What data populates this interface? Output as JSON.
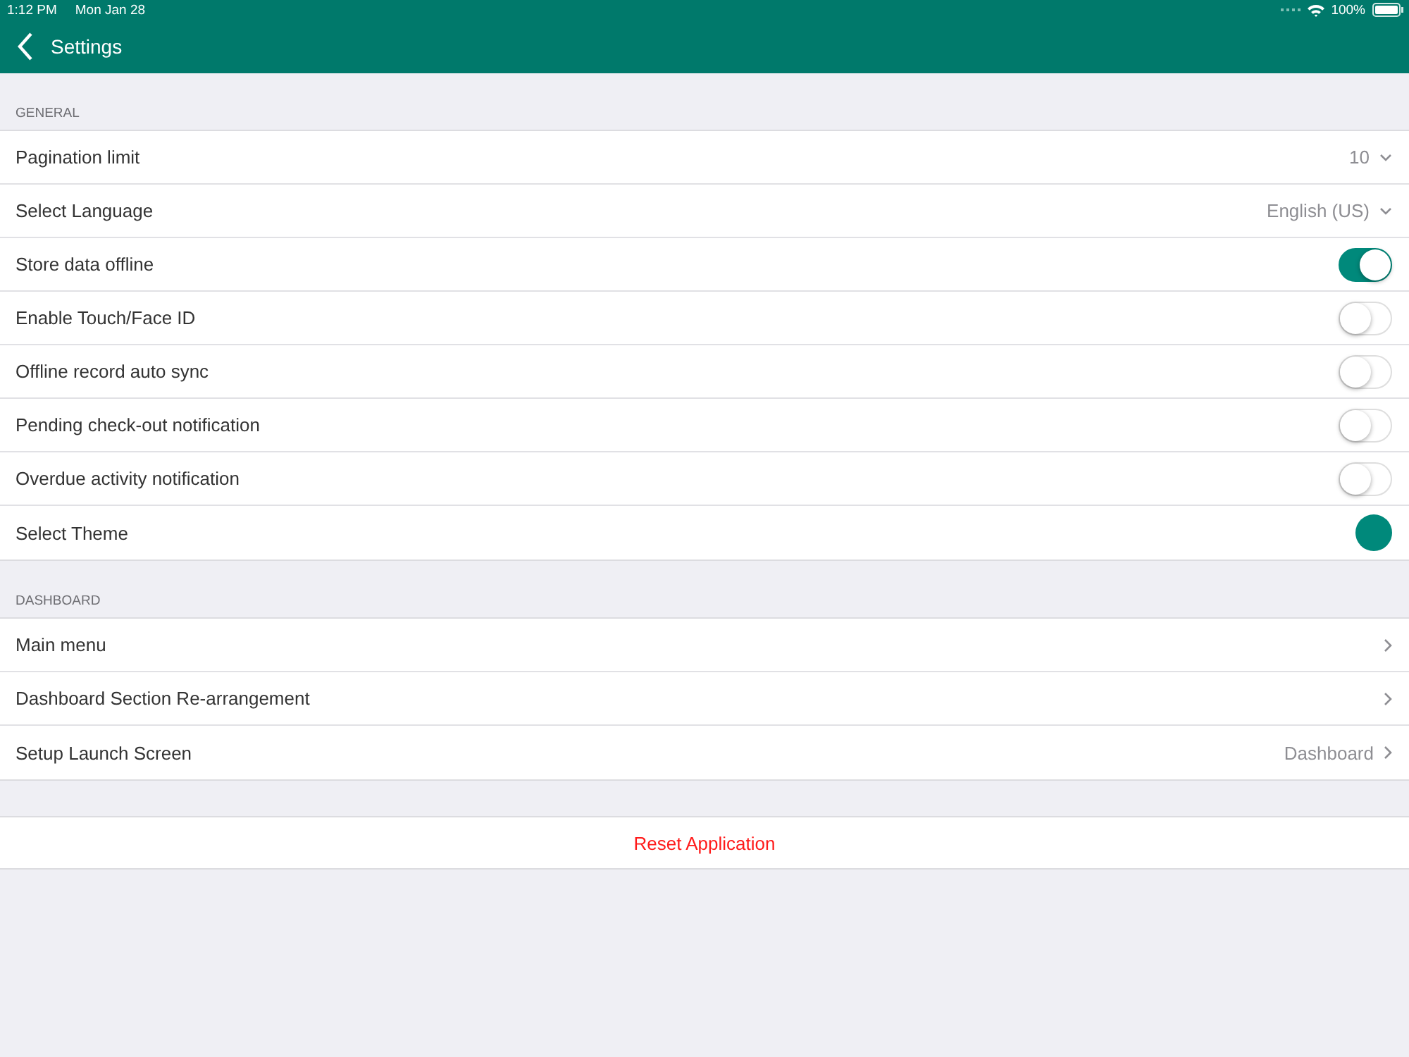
{
  "status_bar": {
    "time": "1:12 PM",
    "date": "Mon Jan 28",
    "battery": "100%"
  },
  "nav": {
    "title": "Settings"
  },
  "sections": [
    {
      "header": "GENERAL",
      "rows": [
        {
          "kind": "dropdown",
          "label": "Pagination limit",
          "value": "10"
        },
        {
          "kind": "dropdown",
          "label": "Select Language",
          "value": "English (US)"
        },
        {
          "kind": "toggle",
          "label": "Store data offline",
          "on": true
        },
        {
          "kind": "toggle",
          "label": "Enable Touch/Face ID",
          "on": false
        },
        {
          "kind": "toggle",
          "label": "Offline record auto sync",
          "on": false
        },
        {
          "kind": "toggle",
          "label": "Pending check-out notification",
          "on": false
        },
        {
          "kind": "toggle",
          "label": "Overdue activity notification",
          "on": false
        },
        {
          "kind": "color",
          "label": "Select Theme",
          "color": "#00897b"
        }
      ]
    },
    {
      "header": "DASHBOARD",
      "rows": [
        {
          "kind": "link",
          "label": "Main menu"
        },
        {
          "kind": "link",
          "label": "Dashboard Section Re-arrangement"
        },
        {
          "kind": "link",
          "label": "Setup Launch Screen",
          "value": "Dashboard"
        }
      ]
    }
  ],
  "reset_button": "Reset Application"
}
